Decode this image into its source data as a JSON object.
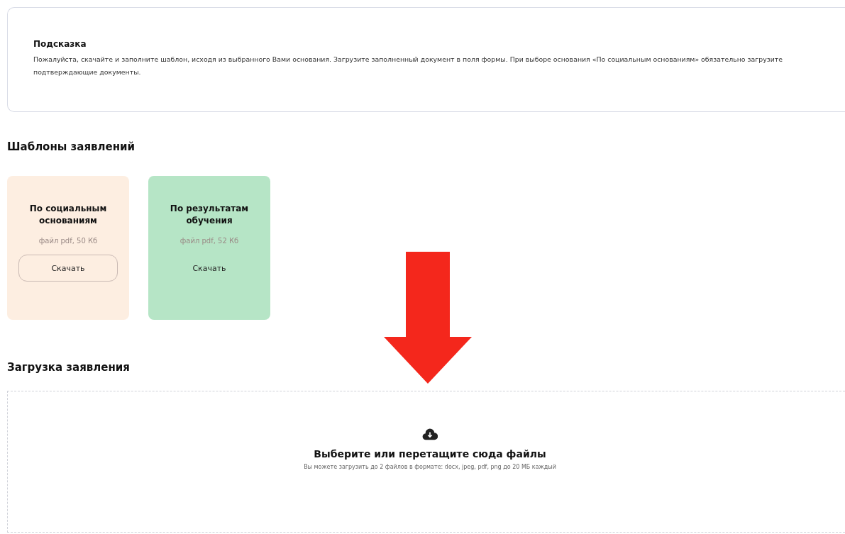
{
  "hint": {
    "title": "Подсказка",
    "text": "Пожалуйста, скачайте и заполните шаблон, исходя из выбранного Вами основания. Загрузите заполненный документ в поля формы. При выборе основания «По социальным основаниям» обязательно загрузите подтверждающие документы."
  },
  "templates": {
    "heading": "Шаблоны заявлений",
    "cards": [
      {
        "title": "По социальным основаниям",
        "file": "файл pdf, 50 Кб",
        "button": {
          "label": "Скачать",
          "kind": "outlined"
        },
        "color": "#fdeee1"
      },
      {
        "title": "По результатам обучения",
        "file": "файл pdf, 52 Кб",
        "button": {
          "label": "Скачать",
          "kind": "plain"
        },
        "color": "#b6e5c6"
      }
    ]
  },
  "upload": {
    "heading": "Загрузка заявления",
    "title": "Выберите или перетащите сюда файлы",
    "note": "Вы можете загрузить до 2 файлов в формате: docx, jpeg, pdf, png до 20 МБ каждый"
  }
}
